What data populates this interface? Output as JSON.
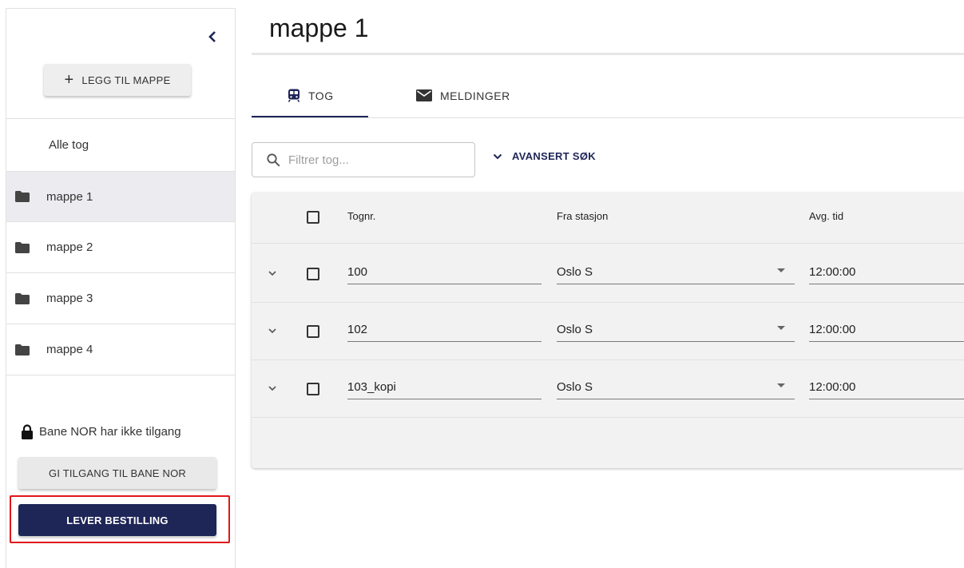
{
  "sidebar": {
    "add_folder_label": "LEGG TIL MAPPE",
    "items": [
      {
        "label": "Alle tog",
        "active": false,
        "icon": "none"
      },
      {
        "label": "mappe 1",
        "active": true,
        "icon": "folder-icon"
      },
      {
        "label": "mappe 2",
        "active": false,
        "icon": "folder-icon"
      },
      {
        "label": "mappe 3",
        "active": false,
        "icon": "folder-icon"
      },
      {
        "label": "mappe 4",
        "active": false,
        "icon": "folder-icon"
      }
    ],
    "access_text": "Bane NOR har ikke tilgang",
    "grant_access_label": "GI TILGANG TIL BANE NOR",
    "deliver_order_label": "LEVER BESTILLING"
  },
  "main": {
    "title": "mappe 1",
    "tabs": [
      {
        "label": "TOG",
        "icon": "train-icon",
        "active": true
      },
      {
        "label": "MELDINGER",
        "icon": "mail-icon",
        "active": false
      }
    ],
    "filter": {
      "placeholder": "Filtrer tog...",
      "value": ""
    },
    "advanced_search_label": "AVANSERT SØK",
    "table": {
      "columns": [
        "Tognr.",
        "Fra stasjon",
        "Avg. tid"
      ],
      "rows": [
        {
          "train_no": "100",
          "from_station": "Oslo S",
          "dep_time": "12:00:00"
        },
        {
          "train_no": "102",
          "from_station": "Oslo S",
          "dep_time": "12:00:00"
        },
        {
          "train_no": "103_kopi",
          "from_station": "Oslo S",
          "dep_time": "12:00:00"
        }
      ]
    }
  },
  "colors": {
    "primary": "#1e2557",
    "highlight": "#e0161a",
    "active_row": "#ececf0",
    "table_bg": "#f2f2f2"
  }
}
